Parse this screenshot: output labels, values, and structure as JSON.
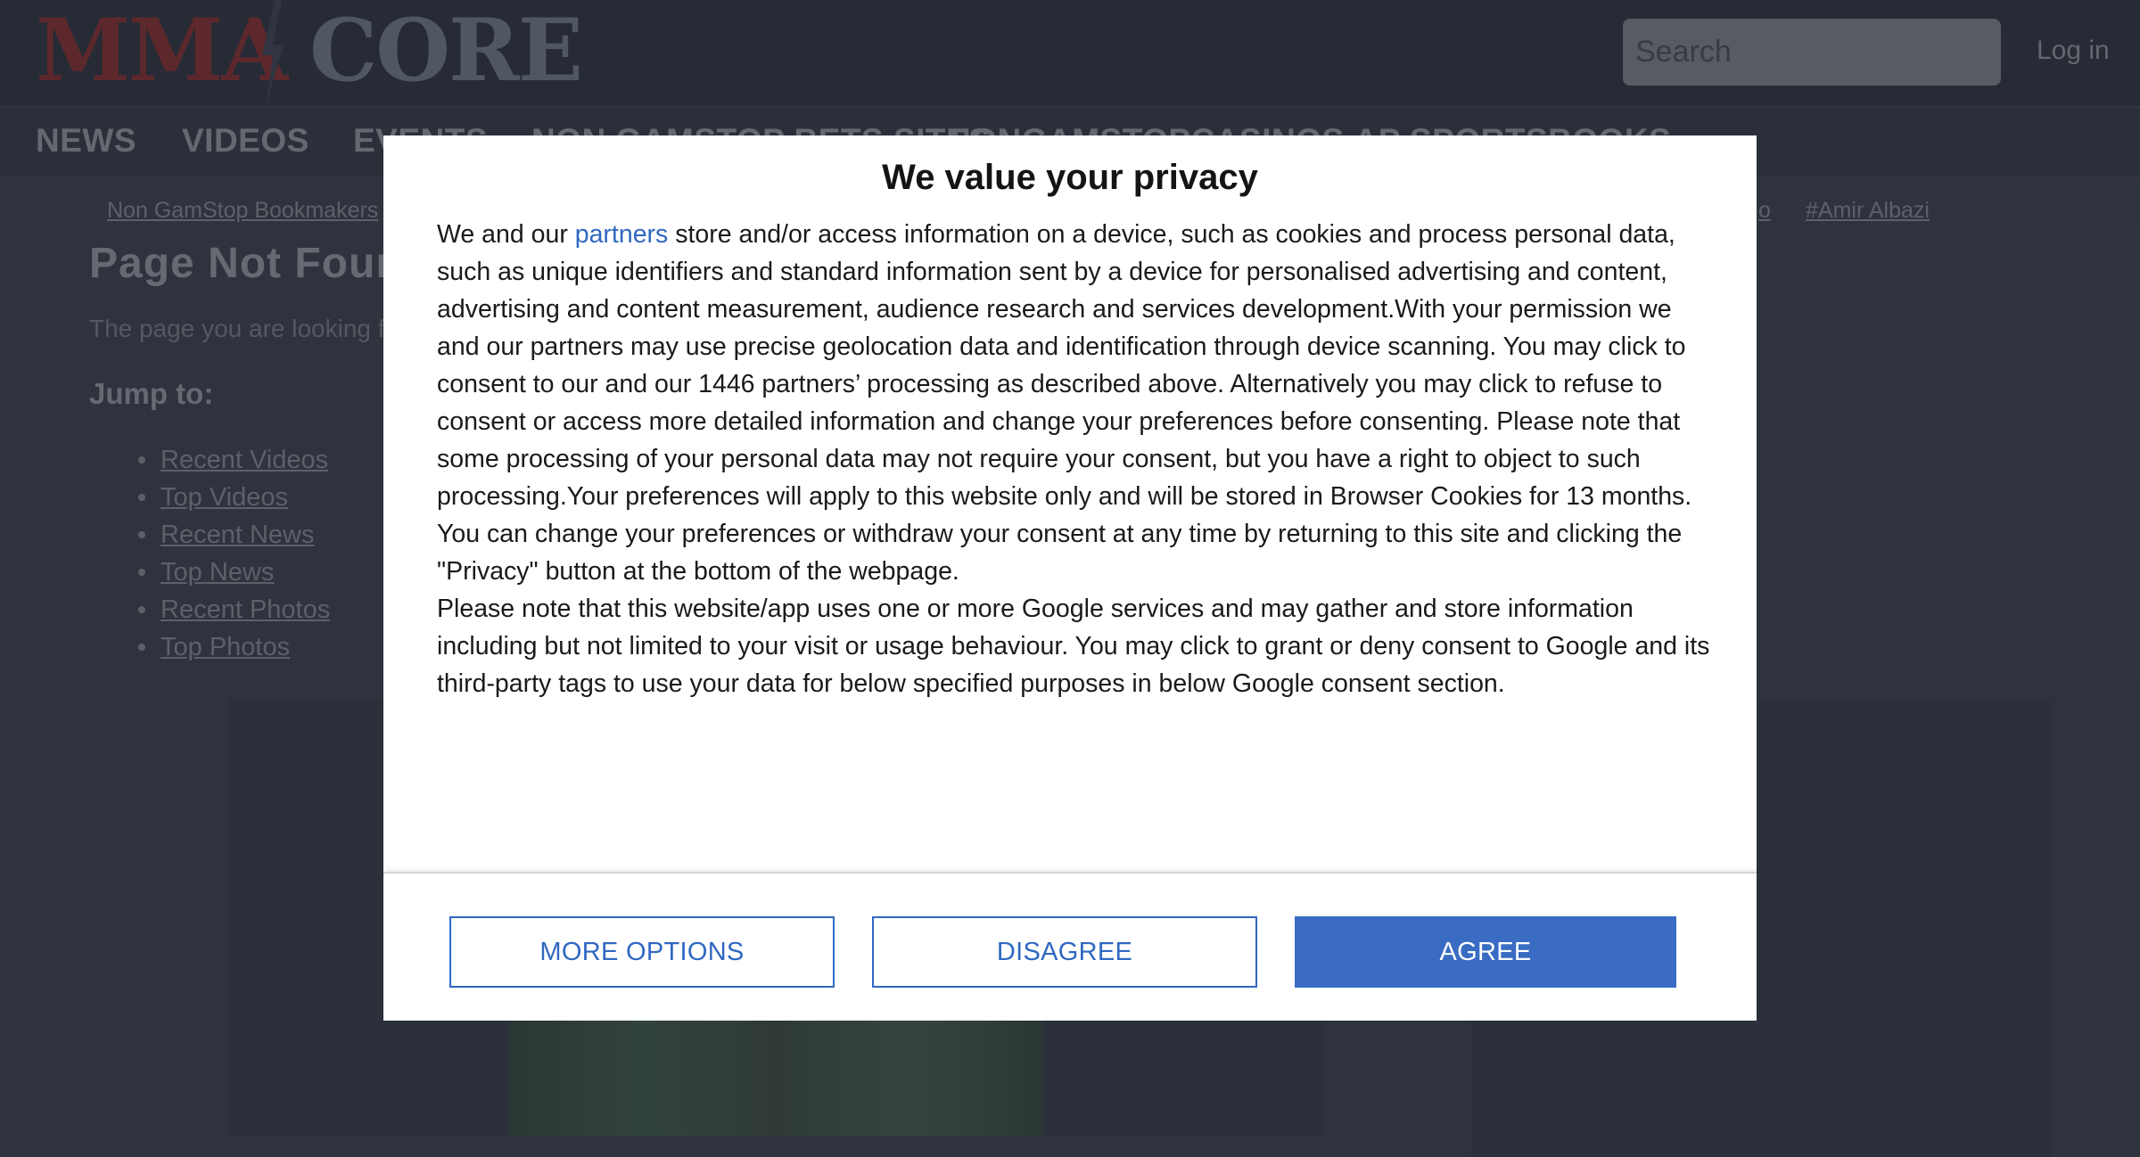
{
  "header": {
    "logo_part1": "MMA",
    "logo_part2": "CORE",
    "search_placeholder": "Search",
    "login_label": "Log in"
  },
  "nav": {
    "items": [
      "NEWS",
      "VIDEOS",
      "EVENTS",
      "NON GAMSTOP BETS SITES",
      "NONGAMSTOPCASINOS.AP SPORTSBOOKS"
    ]
  },
  "tags": {
    "first": "Non GamStop Bookmakers",
    "partial": "o",
    "last": "#Amir Albazi"
  },
  "page": {
    "title": "Page Not Found",
    "message": "The page you are looking for could not be found.",
    "jump_heading": "Jump to:",
    "jump_links": [
      "Recent Videos",
      "Top Videos",
      "Recent News",
      "Top News",
      "Recent Photos",
      "Top Photos"
    ]
  },
  "consent": {
    "title": "We value your privacy",
    "intro_before_link": "We and our ",
    "partners_link": "partners",
    "paragraph1_rest": " store and/or access information on a device, such as cookies and process personal data, such as unique identifiers and standard information sent by a device for personalised advertising and content, advertising and content measurement, audience research and services development.With your permission we and our partners may use precise geolocation data and identification through device scanning. You may click to consent to our and our 1446 partners’ processing as described above. Alternatively you may click to refuse to consent or access more detailed information and change your preferences before consenting. Please note that some processing of your personal data may not require your consent, but you have a right to object to such processing.Your preferences will apply to this website only and will be stored in Browser Cookies for 13 months. You can change your preferences or withdraw your consent at any time by returning to this site and clicking the \"Privacy\" button at the bottom of the webpage.",
    "paragraph2": "Please note that this website/app uses one or more Google services and may gather and store information including but not limited to your visit or usage behaviour. You may click to grant or deny consent to Google and its third-party tags to use your data for below specified purposes in below Google consent section.",
    "buttons": {
      "more_options": "MORE OPTIONS",
      "disagree": "DISAGREE",
      "agree": "AGREE"
    }
  },
  "colors": {
    "accent_blue": "#3a6cc3",
    "page_bg": "#3a3f4b",
    "logo_red": "#8f2a2a"
  }
}
